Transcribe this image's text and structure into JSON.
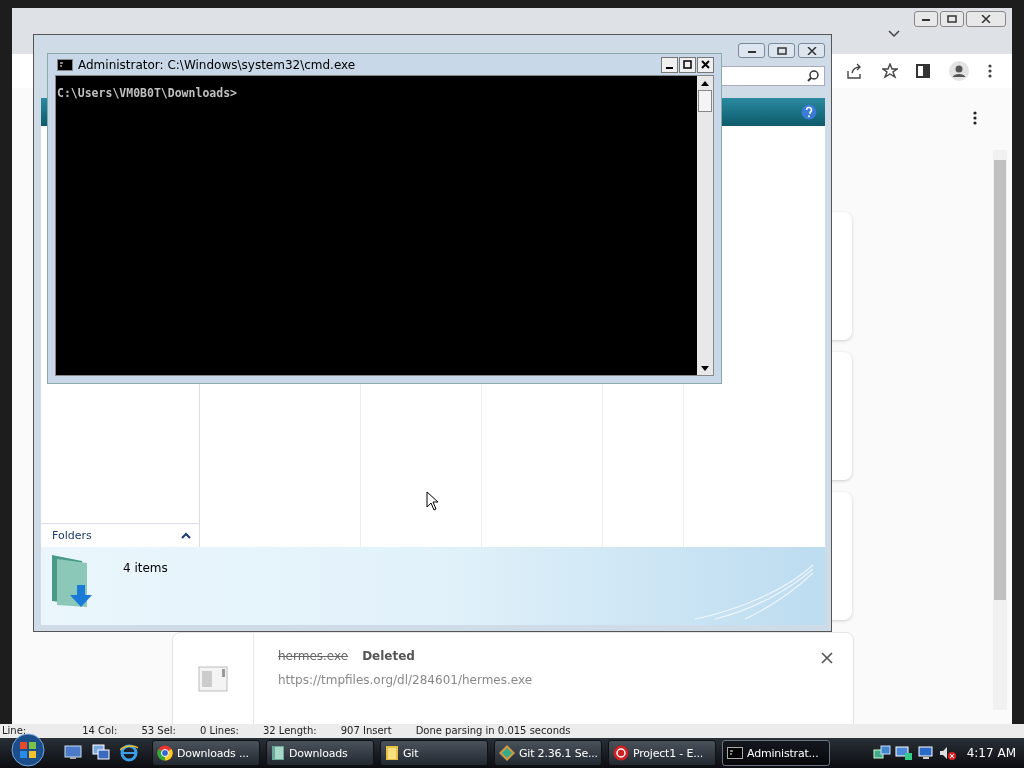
{
  "browser": {
    "download": {
      "file_name": "hermes.exe",
      "deleted": true,
      "status": "Deleted",
      "url": "https://tmpfiles.org/dl/284601/hermes.exe"
    }
  },
  "explorer": {
    "folders_label": "Folders",
    "item_count": "4 items"
  },
  "cmd": {
    "title": "Administrator: C:\\Windows\\system32\\cmd.exe",
    "lines": [
      "C:\\Users\\VM0B0T\\Downloads>"
    ]
  },
  "editor_status": [
    "Line:",
    "14 Col:",
    "53 Sel:",
    "0 Lines:",
    "32 Length:",
    "907 Insert",
    "Done parsing in 0.015 seconds"
  ],
  "taskbar": {
    "tasks": [
      {
        "label": "Downloads ...",
        "kind": "chrome",
        "selected": false
      },
      {
        "label": "Downloads",
        "kind": "explorer",
        "selected": false
      },
      {
        "label": "Git",
        "kind": "folder",
        "selected": false
      },
      {
        "label": "Git 2.36.1 Se...",
        "kind": "git",
        "selected": false
      },
      {
        "label": "Project1 - E...",
        "kind": "devcpp",
        "selected": false
      },
      {
        "label": "Administrat...",
        "kind": "cmd",
        "selected": true
      }
    ],
    "clock": "4:17 AM"
  }
}
